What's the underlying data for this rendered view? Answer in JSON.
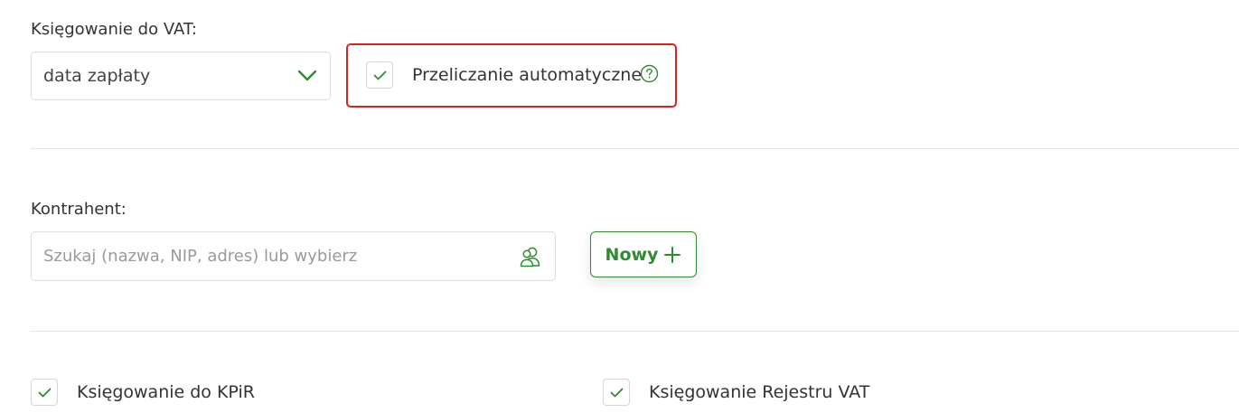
{
  "vat_posting": {
    "label": "Księgowanie do VAT:",
    "selected_value": "data zapłaty",
    "dropdown_icon": "chevron-down-icon"
  },
  "auto_recalc": {
    "label": "Przeliczanie automatyczne",
    "checked": true,
    "help_icon": "question-circle-icon"
  },
  "contractor": {
    "label": "Kontrahent:",
    "search_placeholder": "Szukaj (nazwa, NIP, adres) lub wybierz",
    "search_value": "",
    "search_icon": "contacts-icon",
    "new_button_label": "Nowy",
    "new_button_icon": "plus-icon"
  },
  "posting_options": [
    {
      "label": "Księgowanie do KPiR",
      "checked": true
    },
    {
      "label": "Księgowanie Rejestru VAT",
      "checked": true
    }
  ],
  "colors": {
    "accent": "#2e8b2e",
    "highlight_border": "#e0201b",
    "border": "#dcdcdc",
    "divider": "#e6e6e6"
  }
}
